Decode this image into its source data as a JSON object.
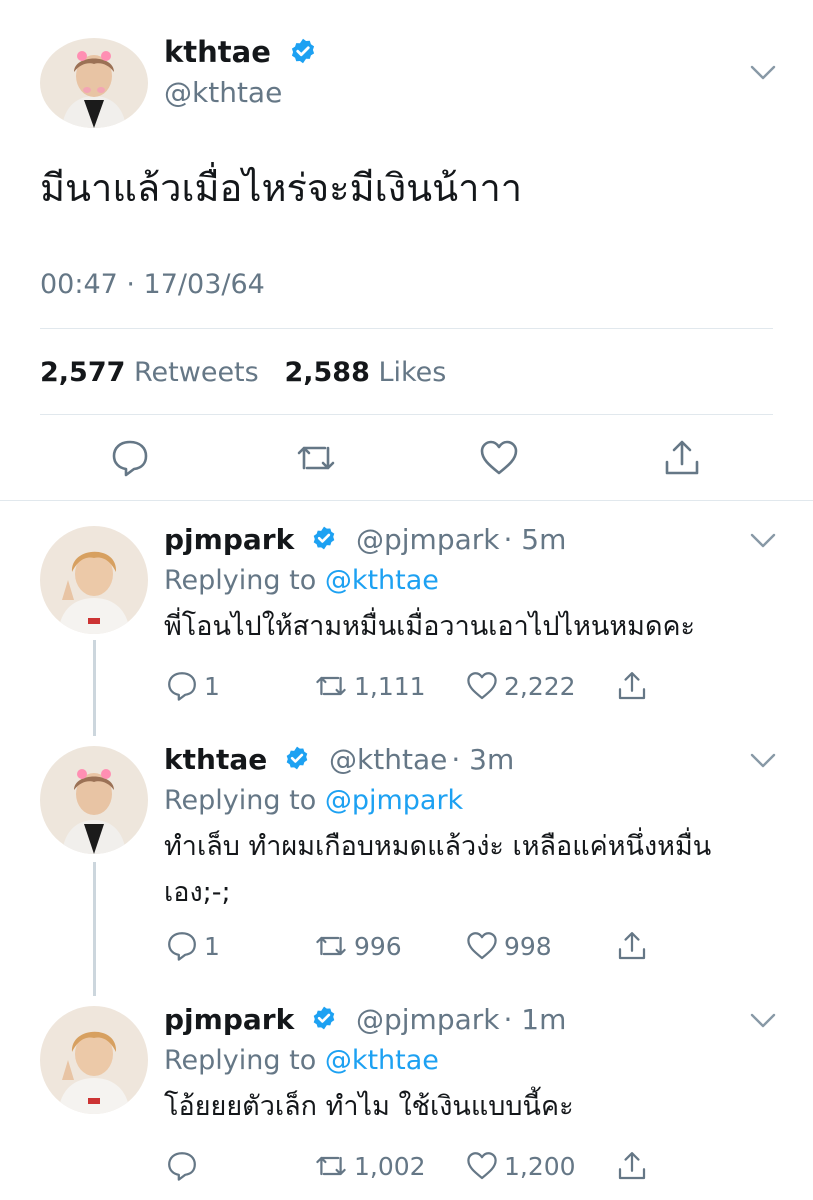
{
  "main": {
    "name": "kthtae",
    "handle": "@kthtae",
    "text": "มีนาแล้วเมื่อไหร่จะมีเงินน้าาา",
    "timestamp": "00:47 · 17/03/64",
    "retweets": "2,577",
    "retweets_label": "Retweets",
    "likes": "2,588",
    "likes_label": "Likes",
    "icons": [
      "reply-icon",
      "retweet-icon",
      "like-icon",
      "share-icon"
    ]
  },
  "replies": [
    {
      "name": "pjmpark",
      "handle": "@pjmpark",
      "time": "· 5m",
      "replying_prefix": "Replying to",
      "replying_to": "@kthtae",
      "text": "พี่โอนไปให้สามหมื่นเมื่อวานเอาไปไหนหมดคะ",
      "reply_count": "1",
      "retweet_count": "1,111",
      "like_count": "2,222"
    },
    {
      "name": "kthtae",
      "handle": "@kthtae",
      "time": "· 3m",
      "replying_prefix": "Replying to",
      "replying_to": "@pjmpark",
      "text": "ทำเล็บ ทำผมเกือบหมดแล้วง่ะ เหลือแค่หนึ่งหมื่นเอง;-;",
      "reply_count": "1",
      "retweet_count": "996",
      "like_count": "998"
    },
    {
      "name": "pjmpark",
      "handle": "@pjmpark",
      "time": "· 1m",
      "replying_prefix": "Replying to",
      "replying_to": "@kthtae",
      "text": "โอ้ยยยตัวเล็ก ทำไม ใช้เงินแบบนี้คะ",
      "reply_count": "",
      "retweet_count": "1,002",
      "like_count": "1,200"
    }
  ],
  "colors": {
    "verified": "#1da1f2",
    "mention": "#1da1f2",
    "secondary_text": "#657786",
    "divider": "#e1e8ed"
  }
}
